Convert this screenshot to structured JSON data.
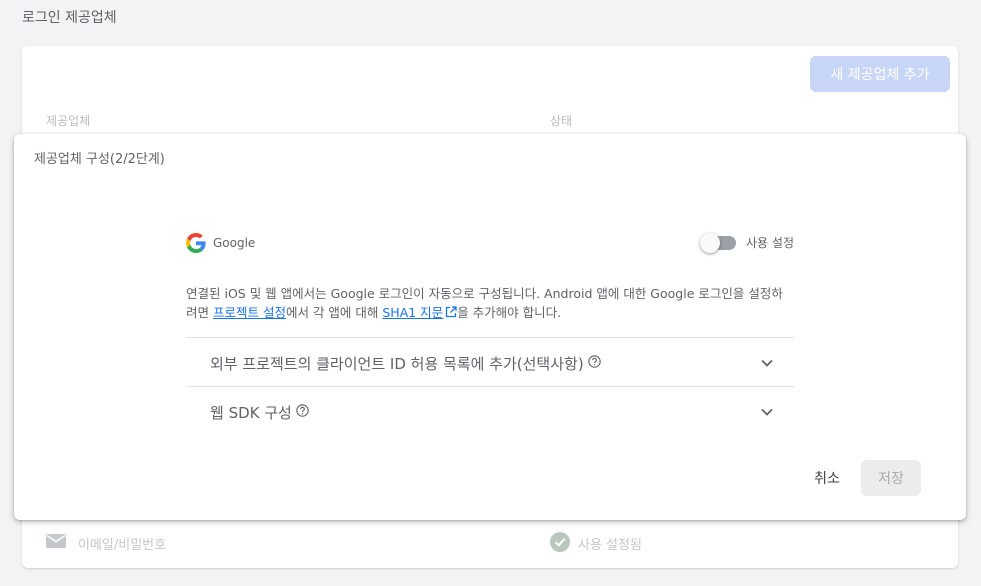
{
  "page": {
    "title": "로그인 제공업체"
  },
  "background": {
    "add_provider_label": "새 제공업체 추가",
    "columns": [
      "제공업체",
      "상태"
    ],
    "row": {
      "icon": "mail-icon",
      "provider": "이메일/비밀번호",
      "status_icon": "check-circle-icon",
      "status": "사용 설정됨"
    }
  },
  "dialog": {
    "title": "제공업체 구성(2/2단계)",
    "provider": {
      "name": "Google",
      "icon": "google-icon"
    },
    "toggle": {
      "label": "사용 설정",
      "enabled": false
    },
    "description": {
      "part1": "연결된 iOS 및 웹 앱에서는 Google 로그인이 자동으로 구성됩니다. Android 앱에 대한 Google 로그인을 설정하려면 ",
      "link1": "프로젝트 설정",
      "part2": "에서 각 앱에 대해 ",
      "link2": "SHA1 지문",
      "part3": "을 추가해야 합니다."
    },
    "accordion": [
      {
        "label": "외부 프로젝트의 클라이언트 ID 허용 목록에 추가(선택사항)"
      },
      {
        "label": "웹 SDK 구성"
      }
    ],
    "cancel_label": "취소",
    "save_label": "저장"
  },
  "colors": {
    "accent": "#1a73e8",
    "disabled_button": "#c7d6f7",
    "toggle_off": "#9aa0a6"
  }
}
